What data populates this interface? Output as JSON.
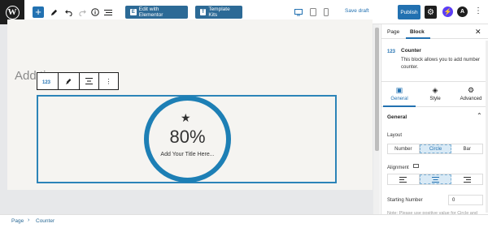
{
  "toolbar": {
    "logo": "W",
    "add": "+",
    "edit_elementor": "Edit with Elementor",
    "edit_elementor_icon": "E",
    "template_kits": "Template Kits",
    "template_kits_icon": "T",
    "save_draft": "Save draft",
    "publish": "Publish"
  },
  "canvas": {
    "title_placeholder": "Add ​ti",
    "counter": {
      "value": "80%",
      "percent": 80,
      "title": "Add Your Title Here..."
    }
  },
  "sidebar": {
    "tabs": [
      "Page",
      "Block"
    ],
    "active_tab": "Block",
    "block_name": "Counter",
    "block_description": "This block allows you to add number counter.",
    "sub_tabs": [
      "General",
      "Style",
      "Advanced"
    ],
    "active_sub_tab": "General",
    "section_title": "General",
    "layout_label": "Layout",
    "layout_options": [
      "Number",
      "Circle",
      "Bar"
    ],
    "layout_selected": "Circle",
    "alignment_label": "Alignment",
    "starting_number_label": "Starting Number",
    "starting_number_value": "0",
    "note": "Note: Please use positive value for Circle and"
  },
  "breadcrumb": [
    "Page",
    "Counter"
  ],
  "colors": {
    "accent": "#2271b1",
    "ring": "#1d7fb5",
    "dark": "#1e1e1e"
  }
}
